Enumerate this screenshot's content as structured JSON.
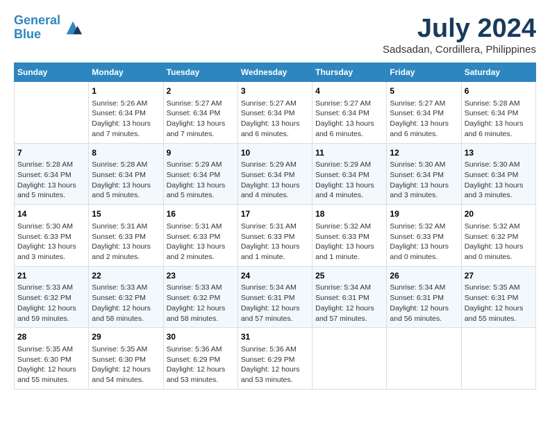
{
  "header": {
    "logo_line1": "General",
    "logo_line2": "Blue",
    "main_title": "July 2024",
    "subtitle": "Sadsadan, Cordillera, Philippines"
  },
  "weekdays": [
    "Sunday",
    "Monday",
    "Tuesday",
    "Wednesday",
    "Thursday",
    "Friday",
    "Saturday"
  ],
  "weeks": [
    [
      {
        "day": "",
        "info": ""
      },
      {
        "day": "1",
        "info": "Sunrise: 5:26 AM\nSunset: 6:34 PM\nDaylight: 13 hours\nand 7 minutes."
      },
      {
        "day": "2",
        "info": "Sunrise: 5:27 AM\nSunset: 6:34 PM\nDaylight: 13 hours\nand 7 minutes."
      },
      {
        "day": "3",
        "info": "Sunrise: 5:27 AM\nSunset: 6:34 PM\nDaylight: 13 hours\nand 6 minutes."
      },
      {
        "day": "4",
        "info": "Sunrise: 5:27 AM\nSunset: 6:34 PM\nDaylight: 13 hours\nand 6 minutes."
      },
      {
        "day": "5",
        "info": "Sunrise: 5:27 AM\nSunset: 6:34 PM\nDaylight: 13 hours\nand 6 minutes."
      },
      {
        "day": "6",
        "info": "Sunrise: 5:28 AM\nSunset: 6:34 PM\nDaylight: 13 hours\nand 6 minutes."
      }
    ],
    [
      {
        "day": "7",
        "info": "Sunrise: 5:28 AM\nSunset: 6:34 PM\nDaylight: 13 hours\nand 5 minutes."
      },
      {
        "day": "8",
        "info": "Sunrise: 5:28 AM\nSunset: 6:34 PM\nDaylight: 13 hours\nand 5 minutes."
      },
      {
        "day": "9",
        "info": "Sunrise: 5:29 AM\nSunset: 6:34 PM\nDaylight: 13 hours\nand 5 minutes."
      },
      {
        "day": "10",
        "info": "Sunrise: 5:29 AM\nSunset: 6:34 PM\nDaylight: 13 hours\nand 4 minutes."
      },
      {
        "day": "11",
        "info": "Sunrise: 5:29 AM\nSunset: 6:34 PM\nDaylight: 13 hours\nand 4 minutes."
      },
      {
        "day": "12",
        "info": "Sunrise: 5:30 AM\nSunset: 6:34 PM\nDaylight: 13 hours\nand 3 minutes."
      },
      {
        "day": "13",
        "info": "Sunrise: 5:30 AM\nSunset: 6:34 PM\nDaylight: 13 hours\nand 3 minutes."
      }
    ],
    [
      {
        "day": "14",
        "info": "Sunrise: 5:30 AM\nSunset: 6:33 PM\nDaylight: 13 hours\nand 3 minutes."
      },
      {
        "day": "15",
        "info": "Sunrise: 5:31 AM\nSunset: 6:33 PM\nDaylight: 13 hours\nand 2 minutes."
      },
      {
        "day": "16",
        "info": "Sunrise: 5:31 AM\nSunset: 6:33 PM\nDaylight: 13 hours\nand 2 minutes."
      },
      {
        "day": "17",
        "info": "Sunrise: 5:31 AM\nSunset: 6:33 PM\nDaylight: 13 hours\nand 1 minute."
      },
      {
        "day": "18",
        "info": "Sunrise: 5:32 AM\nSunset: 6:33 PM\nDaylight: 13 hours\nand 1 minute."
      },
      {
        "day": "19",
        "info": "Sunrise: 5:32 AM\nSunset: 6:33 PM\nDaylight: 13 hours\nand 0 minutes."
      },
      {
        "day": "20",
        "info": "Sunrise: 5:32 AM\nSunset: 6:32 PM\nDaylight: 13 hours\nand 0 minutes."
      }
    ],
    [
      {
        "day": "21",
        "info": "Sunrise: 5:33 AM\nSunset: 6:32 PM\nDaylight: 12 hours\nand 59 minutes."
      },
      {
        "day": "22",
        "info": "Sunrise: 5:33 AM\nSunset: 6:32 PM\nDaylight: 12 hours\nand 58 minutes."
      },
      {
        "day": "23",
        "info": "Sunrise: 5:33 AM\nSunset: 6:32 PM\nDaylight: 12 hours\nand 58 minutes."
      },
      {
        "day": "24",
        "info": "Sunrise: 5:34 AM\nSunset: 6:31 PM\nDaylight: 12 hours\nand 57 minutes."
      },
      {
        "day": "25",
        "info": "Sunrise: 5:34 AM\nSunset: 6:31 PM\nDaylight: 12 hours\nand 57 minutes."
      },
      {
        "day": "26",
        "info": "Sunrise: 5:34 AM\nSunset: 6:31 PM\nDaylight: 12 hours\nand 56 minutes."
      },
      {
        "day": "27",
        "info": "Sunrise: 5:35 AM\nSunset: 6:31 PM\nDaylight: 12 hours\nand 55 minutes."
      }
    ],
    [
      {
        "day": "28",
        "info": "Sunrise: 5:35 AM\nSunset: 6:30 PM\nDaylight: 12 hours\nand 55 minutes."
      },
      {
        "day": "29",
        "info": "Sunrise: 5:35 AM\nSunset: 6:30 PM\nDaylight: 12 hours\nand 54 minutes."
      },
      {
        "day": "30",
        "info": "Sunrise: 5:36 AM\nSunset: 6:29 PM\nDaylight: 12 hours\nand 53 minutes."
      },
      {
        "day": "31",
        "info": "Sunrise: 5:36 AM\nSunset: 6:29 PM\nDaylight: 12 hours\nand 53 minutes."
      },
      {
        "day": "",
        "info": ""
      },
      {
        "day": "",
        "info": ""
      },
      {
        "day": "",
        "info": ""
      }
    ]
  ]
}
